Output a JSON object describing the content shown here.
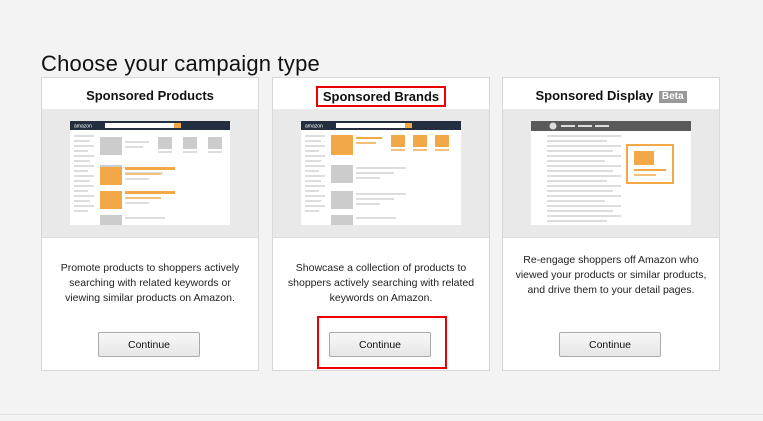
{
  "page": {
    "title": "Choose your campaign type"
  },
  "cards": [
    {
      "title": "Sponsored Products",
      "description": "Promote products to shoppers actively searching with related keywords or viewing similar products on Amazon.",
      "button": "Continue"
    },
    {
      "title": "Sponsored Brands",
      "description": "Showcase a collection of products to shoppers actively searching with related keywords on Amazon.",
      "button": "Continue"
    },
    {
      "title": "Sponsored Display",
      "badge": "Beta",
      "description": "Re-engage shoppers off Amazon who viewed your products or similar products, and drive them to your detail pages.",
      "button": "Continue"
    }
  ],
  "mockup": {
    "logo_text": "amazon"
  },
  "colors": {
    "accent_orange": "#f3a847",
    "mock_header": "#232f3e",
    "highlight": "#e00000"
  }
}
